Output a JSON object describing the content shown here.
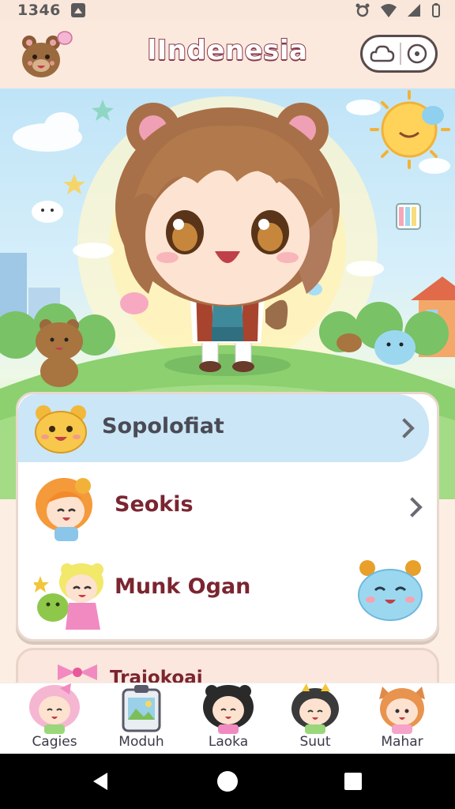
{
  "status_bar": {
    "time": "1346",
    "right_icons": [
      "alarm-icon",
      "wifi-icon",
      "signal-icon",
      "battery-icon"
    ]
  },
  "header": {
    "title": "lIndenesia",
    "logo_icon": "bear-mascot-icon",
    "capsule_icons": [
      "cloud-icon",
      "target-icon"
    ]
  },
  "menu": {
    "items": [
      {
        "label": "Sopolofiat",
        "icon": "bear-face-icon",
        "chevron": true,
        "highlighted": true
      },
      {
        "label": "Seokis",
        "icon": "girl-avatar-icon",
        "chevron": true
      },
      {
        "label": "Munk Ogan",
        "icon": "friends-avatar-icon",
        "chevron": false
      }
    ]
  },
  "peek_item": {
    "label": "Traiokoai"
  },
  "bottom_nav": {
    "items": [
      {
        "label": "Cagies",
        "icon": "pink-girl-icon"
      },
      {
        "label": "Moduh",
        "icon": "clipboard-icon"
      },
      {
        "label": "Laoka",
        "icon": "dark-hair-girl-icon"
      },
      {
        "label": "Suut",
        "icon": "crown-girl-icon"
      },
      {
        "label": "Mahar",
        "icon": "cat-ear-girl-icon"
      }
    ]
  },
  "colors": {
    "title_stroke": "#8a3a4a",
    "highlight": "#cbe6f6",
    "label_dark": "#7a2530"
  }
}
